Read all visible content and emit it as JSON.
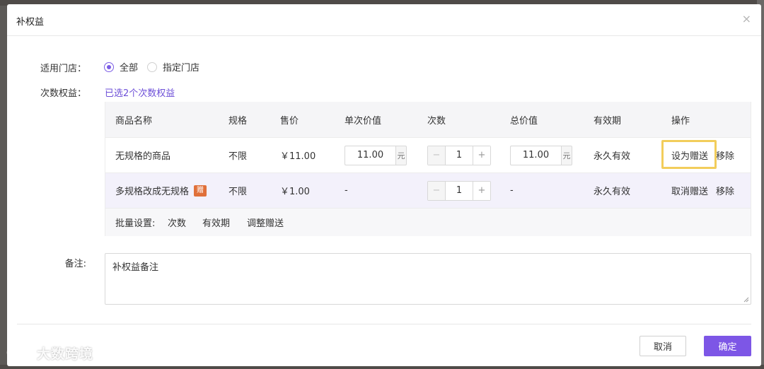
{
  "modal": {
    "title": "补权益",
    "close_glyph": "×"
  },
  "store": {
    "label": "适用门店：",
    "options": [
      {
        "label": "全部",
        "checked": true
      },
      {
        "label": "指定门店",
        "checked": false
      }
    ]
  },
  "benefits": {
    "label": "次数权益：",
    "selected_text": "已选2个次数权益"
  },
  "table": {
    "headers": [
      "商品名称",
      "规格",
      "售价",
      "单次价值",
      "次数",
      "总价值",
      "有效期",
      "操作"
    ],
    "rows": [
      {
        "name": "无规格的商品",
        "badge": "",
        "spec": "不限",
        "price": "￥11.00",
        "unit_value": "11.00",
        "unit_suffix": "元",
        "count": "1",
        "total_value": "11.00",
        "total_suffix": "元",
        "validity": "永久有效",
        "action_primary": "设为赠送",
        "action_remove": "移除"
      },
      {
        "name": "多规格改成无规格",
        "badge": "赠",
        "spec": "不限",
        "price": "￥1.00",
        "unit_value": "-",
        "count": "1",
        "total_value": "-",
        "validity": "永久有效",
        "action_primary": "取消赠送",
        "action_remove": "移除"
      }
    ],
    "batch": {
      "label": "批量设置:",
      "actions": [
        "次数",
        "有效期",
        "调整赠送"
      ]
    },
    "stepper": {
      "minus": "−",
      "plus": "+"
    }
  },
  "remark": {
    "label": "备注:",
    "value": "补权益备注"
  },
  "footer": {
    "cancel": "取消",
    "confirm": "确定"
  },
  "watermark": {
    "text": "大数跨境"
  },
  "colors": {
    "accent": "#7d56e6",
    "link": "#6d4fd8",
    "badge": "#e0703a",
    "highlight": "#f2cd5b"
  }
}
